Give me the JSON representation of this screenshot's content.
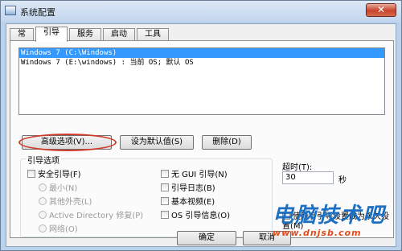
{
  "window": {
    "title": "系统配置",
    "close_glyph": "✕"
  },
  "tabs": [
    {
      "label": "常规"
    },
    {
      "label": "引导"
    },
    {
      "label": "服务"
    },
    {
      "label": "启动"
    },
    {
      "label": "工具"
    }
  ],
  "boot_list": {
    "items": [
      {
        "text": "Windows 7 (C:\\Windows)",
        "selected": true
      },
      {
        "text": "Windows 7 (E:\\windows) : 当前 OS; 默认 OS",
        "selected": false
      }
    ]
  },
  "buttons": {
    "advanced": "高级选项(V)...",
    "set_default": "设为默认值(S)",
    "delete": "删除(D)",
    "ok": "确定",
    "cancel": "取消"
  },
  "boot_options": {
    "title": "引导选项",
    "safe_boot": "安全引导(F)",
    "minimal": "最小(N)",
    "alternate_shell": "其他外壳(L)",
    "active_directory": "Active Directory 修复(P)",
    "network": "网络(O)",
    "no_gui": "无 GUI 引导(N)",
    "boot_log": "引导日志(B)",
    "base_video": "基本视频(E)",
    "os_info": "OS 引导信息(O)"
  },
  "timeout": {
    "label": "超时(T):",
    "value": "30",
    "unit": "秒"
  },
  "make_permanent": "使所有引导设置成为永久设置(M)",
  "watermark": {
    "brand": "电脑技术吧",
    "url": "www.dnjsb.com"
  },
  "colors": {
    "selection": "#3399ff",
    "highlight_ring": "#d23a2a",
    "watermark_blue": "#1c6fc1",
    "watermark_orange": "#e14b1a"
  }
}
